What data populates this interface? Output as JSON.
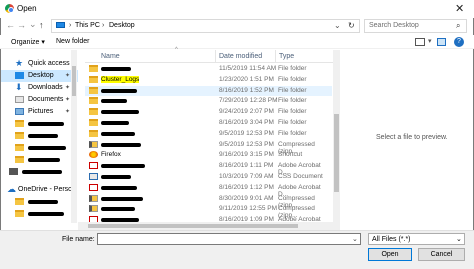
{
  "window": {
    "title": "Open",
    "close": "✕"
  },
  "nav": {
    "back": "←",
    "forward": "→",
    "dropdown": "⌄",
    "up": "↑"
  },
  "address": {
    "crumbs": [
      "This PC",
      "Desktop"
    ],
    "sep": "›",
    "refresh": "↻"
  },
  "search": {
    "placeholder": "Search Desktop",
    "icon": "search-icon"
  },
  "toolbar": {
    "organize": "Organize ▾",
    "new_folder": "New folder"
  },
  "sidebar": {
    "items": [
      {
        "label": "Quick access",
        "icon": "star-icon"
      },
      {
        "label": "Desktop",
        "icon": "desktop-icon",
        "pinned": "📌"
      },
      {
        "label": "Downloads",
        "icon": "download-icon",
        "pinned": "📌"
      },
      {
        "label": "Documents",
        "icon": "document-icon",
        "pinned": "📌"
      },
      {
        "label": "Pictures",
        "icon": "pictures-icon",
        "pinned": "📌"
      },
      {
        "label": "OneDrive - Persor",
        "icon": "cloud-icon"
      }
    ]
  },
  "columns": {
    "name": "Name",
    "date": "Date modified",
    "type": "Type"
  },
  "files": [
    {
      "name": "",
      "date": "11/5/2019 11:54 AM",
      "type": "File folder",
      "icon": "folder"
    },
    {
      "name": "Cluster_Logs",
      "date": "1/23/2020 1:51 PM",
      "type": "File folder",
      "icon": "folder",
      "highlight": true
    },
    {
      "name": "",
      "date": "8/16/2019 1:52 PM",
      "type": "File folder",
      "icon": "folder",
      "selected": true
    },
    {
      "name": "",
      "date": "7/29/2019 12:28 PM",
      "type": "File folder",
      "icon": "folder"
    },
    {
      "name": "",
      "date": "9/24/2019 2:07 PM",
      "type": "File folder",
      "icon": "folder"
    },
    {
      "name": "",
      "date": "8/16/2019 3:04 PM",
      "type": "File folder",
      "icon": "folder"
    },
    {
      "name": "",
      "date": "9/5/2019 12:53 PM",
      "type": "File folder",
      "icon": "folder"
    },
    {
      "name": "",
      "date": "9/5/2019 12:53 PM",
      "type": "Compressed (zipp...",
      "icon": "zip"
    },
    {
      "name": "Firefox",
      "date": "9/16/2019 3:15 PM",
      "type": "Shortcut",
      "icon": "firefox"
    },
    {
      "name": "",
      "date": "8/16/2019 1:11 PM",
      "type": "Adobe Acrobat D...",
      "icon": "pdf"
    },
    {
      "name": "",
      "date": "10/3/2019 7:09 AM",
      "type": "CSS Document",
      "icon": "css"
    },
    {
      "name": "",
      "date": "8/16/2019 1:12 PM",
      "type": "Adobe Acrobat D...",
      "icon": "pdf"
    },
    {
      "name": "",
      "date": "8/30/2019 9:01 AM",
      "type": "Compressed (zipp...",
      "icon": "zip"
    },
    {
      "name": "",
      "date": "9/11/2019 12:55 PM",
      "type": "Compressed (zipp...",
      "icon": "zip"
    },
    {
      "name": "",
      "date": "8/16/2019 1:09 PM",
      "type": "Adobe Acrobat D...",
      "icon": "pdf"
    }
  ],
  "preview": {
    "text": "Select a file to preview."
  },
  "view": {
    "layout_icon": "view-icon",
    "preview_icon": "preview-pane-icon",
    "help_icon": "?"
  },
  "footer": {
    "file_name_label": "File name:",
    "filter": "All Files (*.*)",
    "open": "Open",
    "cancel": "Cancel"
  }
}
